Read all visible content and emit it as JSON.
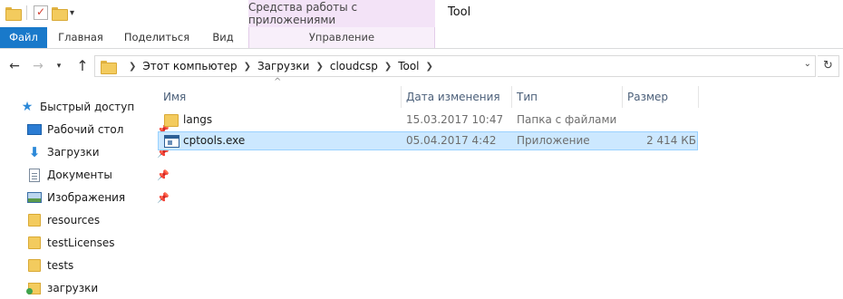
{
  "window": {
    "title": "Tool",
    "contextual_group": "Средства работы с приложениями"
  },
  "quick_access_toolbar": {
    "icons": [
      "folder-icon",
      "properties-check-icon",
      "new-folder-icon",
      "customize-dropdown-icon"
    ]
  },
  "ribbon": {
    "tabs": [
      {
        "label": "Файл",
        "active": true
      },
      {
        "label": "Главная"
      },
      {
        "label": "Поделиться"
      },
      {
        "label": "Вид"
      },
      {
        "label": "Управление"
      }
    ]
  },
  "navigation": {
    "breadcrumbs": [
      "Этот компьютер",
      "Загрузки",
      "cloudcsp",
      "Tool"
    ]
  },
  "sidebar": {
    "quick_access_label": "Быстрый доступ",
    "items": [
      {
        "label": "Рабочий стол",
        "icon": "desktop-icon",
        "pinned": true
      },
      {
        "label": "Загрузки",
        "icon": "download-icon",
        "pinned": true
      },
      {
        "label": "Документы",
        "icon": "documents-icon",
        "pinned": true
      },
      {
        "label": "Изображения",
        "icon": "pictures-icon",
        "pinned": true
      },
      {
        "label": "resources",
        "icon": "folder-icon",
        "pinned": false
      },
      {
        "label": "testLicenses",
        "icon": "folder-icon",
        "pinned": false
      },
      {
        "label": "tests",
        "icon": "folder-icon",
        "pinned": false
      },
      {
        "label": "загрузки",
        "icon": "folder-icon",
        "pinned": false
      }
    ]
  },
  "file_list": {
    "columns": {
      "name": "Имя",
      "modified": "Дата изменения",
      "type": "Тип",
      "size": "Размер"
    },
    "rows": [
      {
        "name": "langs",
        "modified": "15.03.2017 10:47",
        "type": "Папка с файлами",
        "size": "",
        "selected": false
      },
      {
        "name": "cptools.exe",
        "modified": "05.04.2017 4:42",
        "type": "Приложение",
        "size": "2 414 КБ",
        "selected": true
      }
    ]
  },
  "colors": {
    "file_tab": "#1979ca",
    "contextual_tab": "#f3e3f7",
    "selection": "#cce8ff",
    "folder": "#f3cb5e"
  }
}
